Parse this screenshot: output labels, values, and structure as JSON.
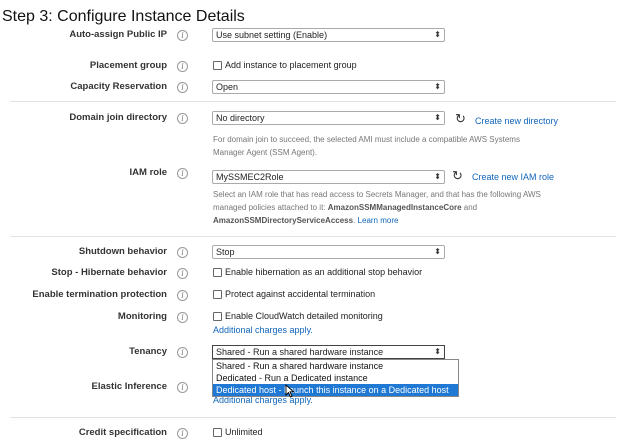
{
  "step_title": "Step 3: Configure Instance Details",
  "rows": {
    "public_ip": {
      "label": "Auto-assign Public IP",
      "value": "Use subnet setting (Enable)"
    },
    "placement": {
      "label": "Placement group",
      "checkbox_label": "Add instance to placement group"
    },
    "capacity": {
      "label": "Capacity Reservation",
      "value": "Open"
    },
    "domain": {
      "label": "Domain join directory",
      "value": "No directory",
      "link": "Create new directory",
      "help_line1": "For domain join to succeed, the selected AMI must include a compatible AWS Systems",
      "help_line2": "Manager Agent (SSM Agent)."
    },
    "iam": {
      "label": "IAM role",
      "value": "MySSMEC2Role",
      "link": "Create new IAM role",
      "help_line1": "Select an IAM role that has read access to Secrets Manager, and that has the following AWS",
      "help_line2_pre": "managed policies attached to it: ",
      "policy1": "AmazonSSMManagedInstanceCore",
      "help_and": " and",
      "policy2": "AmazonSSMDirectoryServiceAccess",
      "help_dot": ".",
      "learn_more": "Learn more"
    },
    "shutdown": {
      "label": "Shutdown behavior",
      "value": "Stop"
    },
    "hibernate": {
      "label": "Stop - Hibernate behavior",
      "checkbox_label": "Enable hibernation as an additional stop behavior"
    },
    "termination": {
      "label": "Enable termination protection",
      "checkbox_label": "Protect against accidental termination"
    },
    "monitoring": {
      "label": "Monitoring",
      "checkbox_label": "Enable CloudWatch detailed monitoring",
      "charges": "Additional charges apply."
    },
    "tenancy": {
      "label": "Tenancy",
      "value": "Shared - Run a shared hardware instance",
      "options": [
        "Shared - Run a shared hardware instance",
        "Dedicated - Run a Dedicated instance",
        "Dedicated host - Launch this instance on a Dedicated host"
      ]
    },
    "elastic": {
      "label": "Elastic Inference",
      "charges": "Additional charges apply."
    },
    "credit": {
      "label": "Credit specification",
      "checkbox_label": "Unlimited"
    }
  },
  "icons": {
    "info": "i",
    "refresh": "↻",
    "select_arrow": "⬍"
  }
}
